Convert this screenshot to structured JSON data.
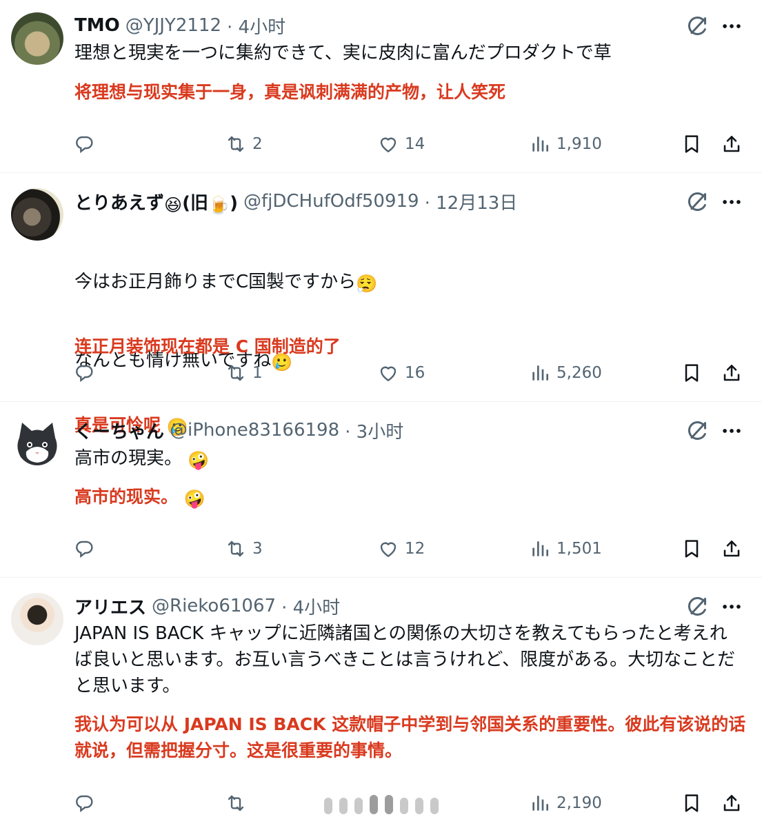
{
  "tweets": [
    {
      "name": "TMO",
      "handle": "@YJJY2112",
      "time": "· 4小时",
      "text_jp": "理想と現実を一つに集約できて、実に皮肉に富んだプロダクトで草",
      "text_cn": "将理想与现实集于一身，真是讽刺满满的产物，让人笑死",
      "reply_count": "",
      "retweet_count": "2",
      "like_count": "14",
      "view_count": "1,910"
    },
    {
      "name": "とりあえず",
      "name_emoji": "😆",
      "name_paren": "(旧",
      "name_emoji2": "🍺",
      "name_close": ")",
      "handle": "@fjDCHufOdf50919",
      "time": "· 12月13日",
      "text_jp_line1": "今はお正月飾りまでC国製ですから",
      "text_jp_emoji1": "😮‍💨",
      "text_jp_line2": "なんとも情け無いですね",
      "text_jp_emoji2": "🥲",
      "text_cn_line1": "连正月装饰现在都是 C 国制造的了",
      "text_cn_line2": "真是可怜呢",
      "text_cn_emoji": "🥲",
      "reply_count": "",
      "retweet_count": "1",
      "like_count": "16",
      "view_count": "5,260"
    },
    {
      "name": "くーちゃん",
      "handle": "@iPhone83166198",
      "time": "· 3小时",
      "text_jp": "高市の現実。",
      "text_jp_emoji": "🤪",
      "text_cn": "高市的现实。",
      "text_cn_emoji": "🤪",
      "reply_count": "",
      "retweet_count": "3",
      "like_count": "12",
      "view_count": "1,501"
    },
    {
      "name": "アリエス",
      "handle": "@Rieko61067",
      "time": "· 4小时",
      "text_jp": "JAPAN IS BACK キャップに近隣諸国との関係の大切さを教えてもらったと考えれば良いと思います。お互い言うべきことは言うけれど、限度がある。大切なことだと思います。",
      "text_cn": "我认为可以从 JAPAN IS BACK 这款帽子中学到与邻国关系的重要性。彼此有该说的话就说，但需把握分寸。这是很重要的事情。",
      "reply_count": "",
      "retweet_count": "",
      "like_count": "",
      "view_count": "2,190"
    }
  ],
  "icons": {
    "reply": "reply-icon",
    "retweet": "retweet-icon",
    "like": "heart-icon",
    "views": "views-icon",
    "bookmark": "bookmark-icon",
    "share": "share-icon",
    "grok": "grok-icon",
    "more": "more-icon"
  },
  "colors": {
    "translation_red": "#d93a1f",
    "secondary_gray": "#536471",
    "divider": "#eff3f4"
  }
}
